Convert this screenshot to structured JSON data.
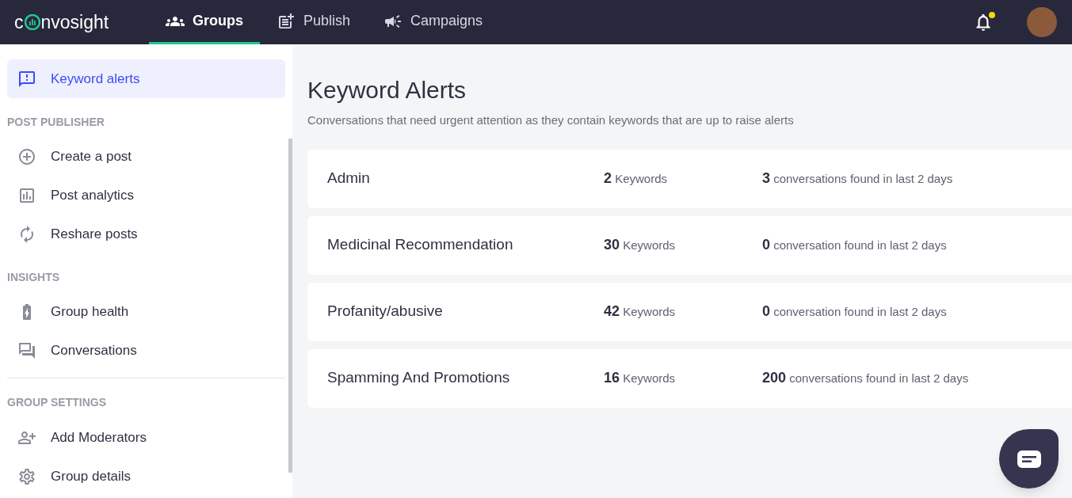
{
  "logo": {
    "before": "c",
    "after": "nvosight"
  },
  "nav": [
    {
      "label": "Groups",
      "selected": true
    },
    {
      "label": "Publish",
      "selected": false
    },
    {
      "label": "Campaigns",
      "selected": false
    }
  ],
  "notifications": {
    "unread": true
  },
  "sidebar": {
    "top_items": [
      {
        "label": "Keyword alerts",
        "selected": true
      }
    ],
    "sections": [
      {
        "title": "POST PUBLISHER",
        "divider": false,
        "items": [
          {
            "label": "Create a post",
            "selected": false
          },
          {
            "label": "Post analytics",
            "selected": false
          },
          {
            "label": "Reshare posts",
            "selected": false
          }
        ]
      },
      {
        "title": "INSIGHTS",
        "divider": false,
        "items": [
          {
            "label": "Group health",
            "selected": false
          },
          {
            "label": "Conversations",
            "selected": false
          }
        ]
      },
      {
        "title": "GROUP SETTINGS",
        "divider": true,
        "items": [
          {
            "label": "Add Moderators",
            "selected": false
          },
          {
            "label": "Group details",
            "selected": false
          }
        ]
      }
    ]
  },
  "page": {
    "title": "Keyword Alerts",
    "subtitle": "Conversations that need urgent attention as they contain keywords that are up to raise alerts"
  },
  "alerts": [
    {
      "name": "Admin",
      "keyword_count": "2",
      "keyword_label": "Keywords",
      "conversation_count": "3",
      "conversation_label": "conversations found in last 2 days"
    },
    {
      "name": "Medicinal Recommendation",
      "keyword_count": "30",
      "keyword_label": "Keywords",
      "conversation_count": "0",
      "conversation_label": "conversation found in last 2 days"
    },
    {
      "name": "Profanity/abusive",
      "keyword_count": "42",
      "keyword_label": "Keywords",
      "conversation_count": "0",
      "conversation_label": "conversation found in last 2 days"
    },
    {
      "name": "Spamming And Promotions",
      "keyword_count": "16",
      "keyword_label": "Keywords",
      "conversation_count": "200",
      "conversation_label": "conversations found in last 2 days"
    }
  ]
}
